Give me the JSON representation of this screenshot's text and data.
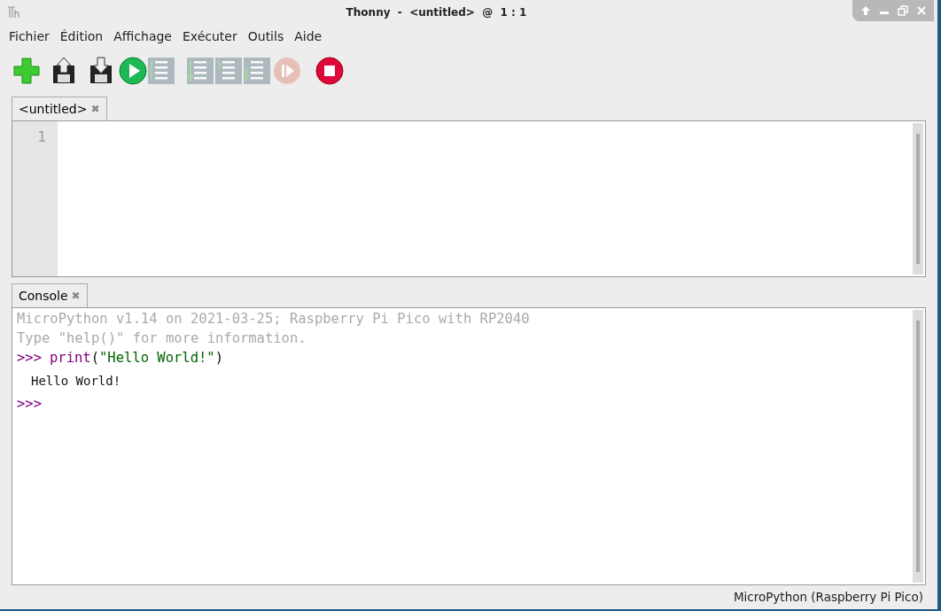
{
  "window": {
    "title": "Thonny  -  <untitled>  @  1 : 1"
  },
  "menu": [
    "Fichier",
    "Édition",
    "Affichage",
    "Exécuter",
    "Outils",
    "Aide"
  ],
  "toolbar": [
    {
      "kind": "new",
      "disabled": false
    },
    {
      "kind": "open",
      "disabled": false
    },
    {
      "kind": "save",
      "disabled": false
    },
    {
      "kind": "run",
      "disabled": false
    },
    {
      "kind": "debug",
      "disabled": true
    },
    {
      "kind": "step_over",
      "disabled": true
    },
    {
      "kind": "step_into",
      "disabled": true
    },
    {
      "kind": "step_out",
      "disabled": true
    },
    {
      "kind": "resume",
      "disabled": true
    },
    {
      "kind": "stop",
      "disabled": false
    }
  ],
  "editor": {
    "tab": {
      "label": "<untitled>",
      "close": "✖"
    },
    "line_numbers": [
      "1"
    ]
  },
  "console": {
    "tab": {
      "label": "Console",
      "close": "✖"
    },
    "lines": [
      {
        "kind": "banner",
        "text": "MicroPython v1.14 on 2021-03-25; Raspberry Pi Pico with RP2040"
      },
      {
        "kind": "banner",
        "text": "Type \"help()\" for more information."
      },
      {
        "kind": "input",
        "prompt": ">>>",
        "code": [
          {
            "kind": "builtin",
            "text": "print"
          },
          {
            "kind": "punct",
            "text": "("
          },
          {
            "kind": "string",
            "text": "\"Hello World!\""
          },
          {
            "kind": "punct",
            "text": ")"
          }
        ]
      },
      {
        "kind": "output",
        "text": "Hello World!"
      },
      {
        "kind": "input",
        "prompt": ">>>"
      }
    ]
  },
  "status_bar": {
    "interpreter": "MicroPython (Raspberry Pi Pico)"
  }
}
